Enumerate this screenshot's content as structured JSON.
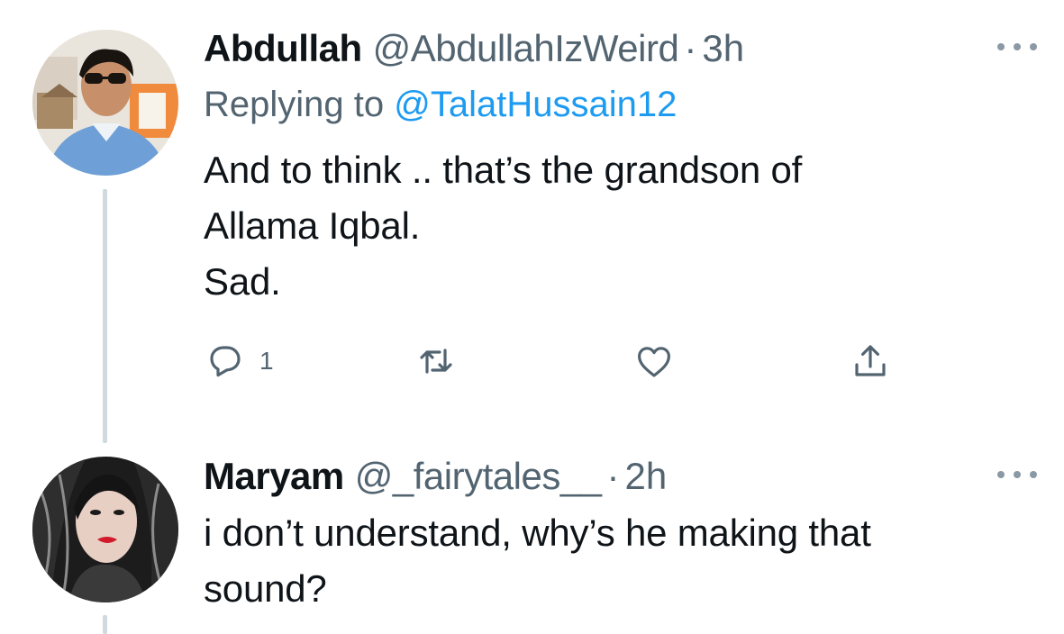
{
  "tweets": [
    {
      "display_name": "Abdullah",
      "handle": "@AbdullahIzWeird",
      "separator": "·",
      "time": "3h",
      "replying_prefix": "Replying to",
      "replying_to": "@TalatHussain12",
      "text": "And to think .. that’s the grandson of\nAllama Iqbal.\nSad.",
      "actions": {
        "reply_icon": "reply-icon",
        "reply_count": "1",
        "retweet_icon": "retweet-icon",
        "like_icon": "heart-icon",
        "share_icon": "share-icon"
      },
      "avatar_colors": {
        "sky": "#e9e4dc",
        "shirt": "#6e9fd6",
        "skin": "#c7906b",
        "hair": "#1a1410"
      }
    },
    {
      "display_name": "Maryam",
      "handle": "@_fairytales__",
      "separator": "·",
      "time": "2h",
      "text": "i don’t understand, why’s he making that\nsound?",
      "avatar_colors": {
        "bg": "#1c1c1c",
        "skin": "#e8cfc4",
        "lips": "#d11a2a"
      }
    }
  ],
  "colors": {
    "text": "#0f1419",
    "secondary": "#536471",
    "link": "#1d9bf0",
    "thread_line": "#cfd9de"
  }
}
